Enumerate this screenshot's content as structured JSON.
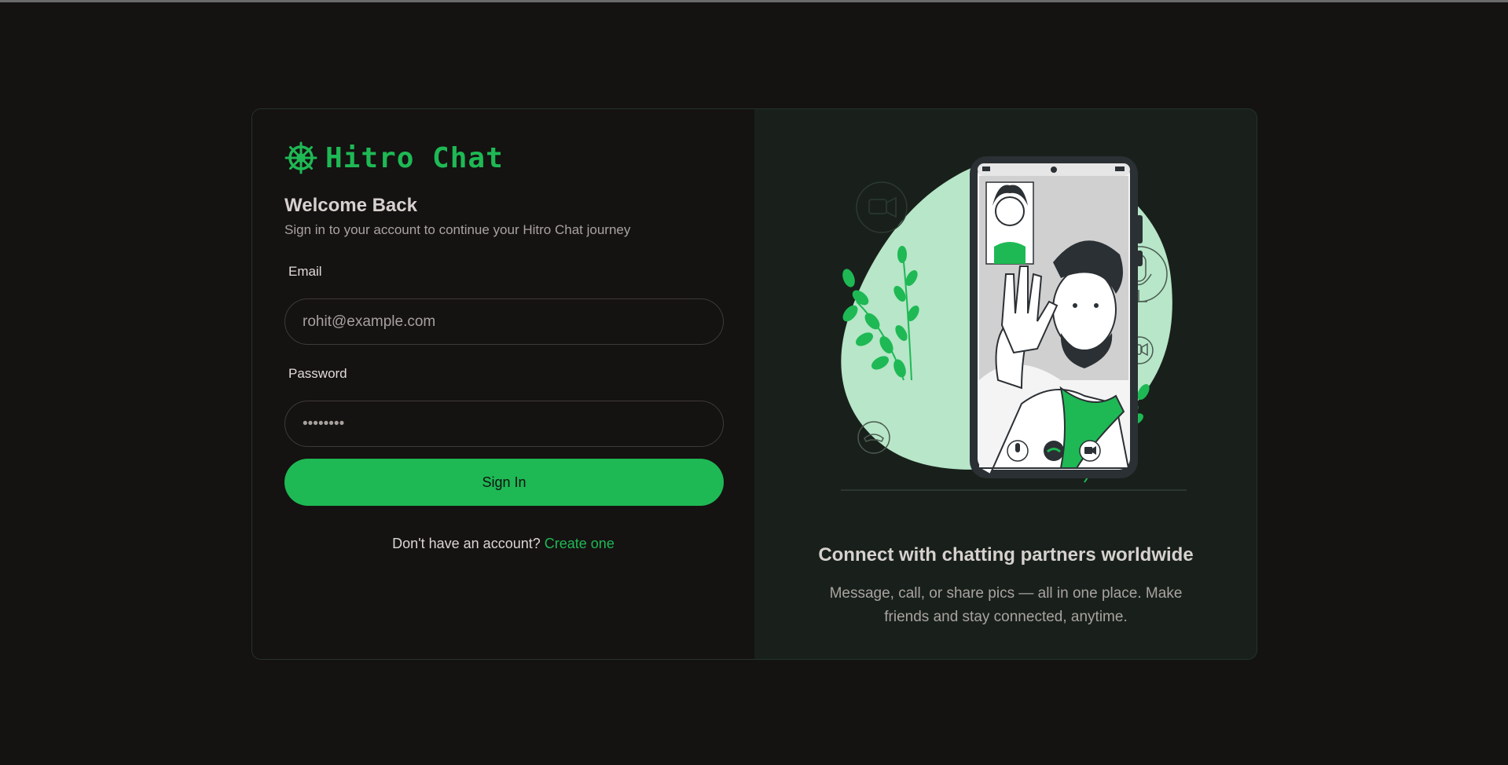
{
  "brand": {
    "name": "Hitro Chat",
    "icon": "dharma-wheel-icon",
    "color": "#1eb954"
  },
  "login": {
    "title": "Welcome Back",
    "subtitle": "Sign in to your account to continue your Hitro Chat journey",
    "email": {
      "label": "Email",
      "value": "rohit@example.com"
    },
    "password": {
      "label": "Password",
      "value": "••••••••"
    },
    "submit_label": "Sign In",
    "signup_prompt": "Don't have an account?",
    "signup_link": "Create one"
  },
  "promo": {
    "title": "Connect with chatting partners worldwide",
    "description": "Message, call, or share pics — all in one place. Make friends and stay connected, anytime."
  }
}
